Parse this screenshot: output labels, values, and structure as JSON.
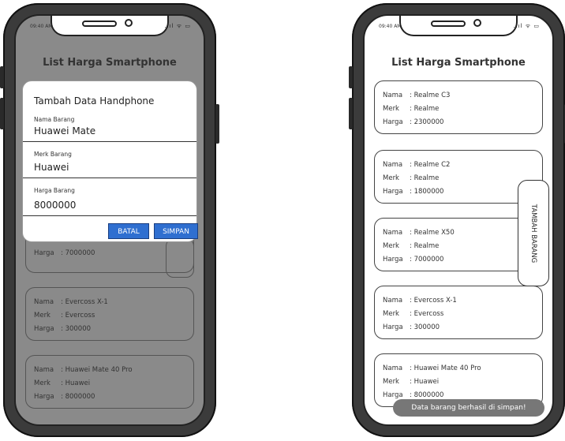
{
  "status": {
    "time": "09:40 AM",
    "icons": "..ıl ᯤ ▭"
  },
  "app": {
    "title": "List Harga Smartphone"
  },
  "labels": {
    "nama": "Nama",
    "merk": "Merk",
    "harga": "Harga",
    "sep": ":"
  },
  "left_phone": {
    "dialog": {
      "title": "Tambah Data Handphone",
      "fields": [
        {
          "label": "Nama Barang",
          "value": "Huawei Mate"
        },
        {
          "label": "Merk Barang",
          "value": "Huawei"
        },
        {
          "label": "Harga Barang",
          "value": "8000000"
        }
      ],
      "cancel_label": "BATAL",
      "save_label": "SIMPAN"
    },
    "cards": [
      {
        "harga": "7000000"
      },
      {
        "nama": "Evercoss X-1",
        "merk": "Evercoss",
        "harga": "300000"
      },
      {
        "nama": "Huawei Mate 40 Pro",
        "merk": "Huawei",
        "harga": "8000000"
      }
    ]
  },
  "right_phone": {
    "cards": [
      {
        "nama": "Realme C3",
        "merk": "Realme",
        "harga": "2300000"
      },
      {
        "nama": "Realme C2",
        "merk": "Realme",
        "harga": "1800000"
      },
      {
        "nama": "Realme X50",
        "merk": "Realme",
        "harga": "7000000"
      },
      {
        "nama": "Evercoss X-1",
        "merk": "Evercoss",
        "harga": "300000"
      },
      {
        "nama": "Huawei Mate 40 Pro",
        "merk": "Huawei",
        "harga": "8000000"
      }
    ],
    "fab_label": "TAMBAH BARANG",
    "toast": "Data barang berhasil di simpan!"
  }
}
